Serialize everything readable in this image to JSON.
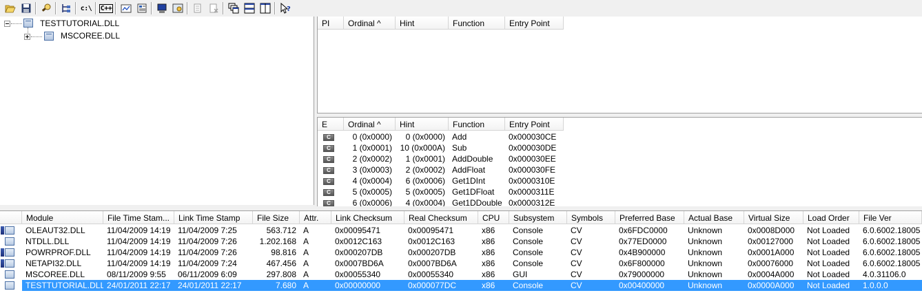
{
  "toolbar": {
    "buttons": [
      {
        "icon": "open-folder-icon"
      },
      {
        "icon": "save-icon"
      },
      {
        "icon": "find-icon"
      },
      {
        "icon": "module-tree-icon"
      },
      {
        "label": "c:\\"
      },
      {
        "label": "C++"
      },
      {
        "icon": "profile-icon"
      },
      {
        "icon": "properties-icon"
      },
      {
        "icon": "computer-icon"
      },
      {
        "icon": "view-icon"
      },
      {
        "icon": "copy-icon"
      },
      {
        "icon": "delete-icon"
      },
      {
        "icon": "cascade-icon"
      },
      {
        "icon": "tile-horizontal-icon"
      },
      {
        "icon": "tile-vertical-icon"
      },
      {
        "icon": "help-icon"
      }
    ]
  },
  "tree": {
    "root": "TESTTUTORIAL.DLL",
    "child": "MSCOREE.DLL"
  },
  "imports": {
    "headers": [
      "PI",
      "Ordinal ^",
      "Hint",
      "Function",
      "Entry Point"
    ]
  },
  "exports": {
    "headers": [
      "E",
      "Ordinal ^",
      "Hint",
      "Function",
      "Entry Point"
    ],
    "badge": "C",
    "rows": [
      {
        "ordinal": "0 (0x0000)",
        "hint": "0 (0x0000)",
        "function": "Add",
        "entry": "0x000030CE"
      },
      {
        "ordinal": "1 (0x0001)",
        "hint": "10 (0x000A)",
        "function": "Sub",
        "entry": "0x000030DE"
      },
      {
        "ordinal": "2 (0x0002)",
        "hint": "1 (0x0001)",
        "function": "AddDouble",
        "entry": "0x000030EE"
      },
      {
        "ordinal": "3 (0x0003)",
        "hint": "2 (0x0002)",
        "function": "AddFloat",
        "entry": "0x000030FE"
      },
      {
        "ordinal": "4 (0x0004)",
        "hint": "6 (0x0006)",
        "function": "Get1DInt",
        "entry": "0x0000310E"
      },
      {
        "ordinal": "5 (0x0005)",
        "hint": "5 (0x0005)",
        "function": "Get1DFloat",
        "entry": "0x0000311E"
      },
      {
        "ordinal": "6 (0x0006)",
        "hint": "4 (0x0004)",
        "function": "Get1DDouble",
        "entry": "0x0000312E"
      }
    ]
  },
  "modules": {
    "headers": [
      "",
      "Module",
      "File Time Stam...",
      "Link Time Stamp",
      "File Size",
      "Attr.",
      "Link Checksum",
      "Real Checksum",
      "CPU",
      "Subsystem",
      "Symbols",
      "Preferred Base",
      "Actual Base",
      "Virtual Size",
      "Load Order",
      "File Ver"
    ],
    "rows": [
      {
        "icon": "warn",
        "module": "OLEAUT32.DLL",
        "file_time": "11/04/2009 14:19",
        "link_time": "11/04/2009  7:25",
        "size": "563.712",
        "attr": "A",
        "link_ck": "0x00095471",
        "real_ck": "0x00095471",
        "cpu": "x86",
        "subsystem": "Console",
        "symbols": "CV",
        "pref_base": "0x6FDC0000",
        "actual_base": "Unknown",
        "vsize": "0x0008D000",
        "load_order": "Not Loaded",
        "file_ver": "6.0.6002.18005"
      },
      {
        "icon": "plain",
        "module": "NTDLL.DLL",
        "file_time": "11/04/2009 14:19",
        "link_time": "11/04/2009  7:26",
        "size": "1.202.168",
        "attr": "A",
        "link_ck": "0x0012C163",
        "real_ck": "0x0012C163",
        "cpu": "x86",
        "subsystem": "Console",
        "symbols": "CV",
        "pref_base": "0x77ED0000",
        "actual_base": "Unknown",
        "vsize": "0x00127000",
        "load_order": "Not Loaded",
        "file_ver": "6.0.6002.18005"
      },
      {
        "icon": "warn",
        "module": "POWRPROF.DLL",
        "file_time": "11/04/2009 14:19",
        "link_time": "11/04/2009  7:26",
        "size": "98.816",
        "attr": "A",
        "link_ck": "0x000207DB",
        "real_ck": "0x000207DB",
        "cpu": "x86",
        "subsystem": "Console",
        "symbols": "CV",
        "pref_base": "0x4B900000",
        "actual_base": "Unknown",
        "vsize": "0x0001A000",
        "load_order": "Not Loaded",
        "file_ver": "6.0.6002.18005"
      },
      {
        "icon": "warn",
        "module": "NETAPI32.DLL",
        "file_time": "11/04/2009 14:19",
        "link_time": "11/04/2009  7:24",
        "size": "467.456",
        "attr": "A",
        "link_ck": "0x0007BD6A",
        "real_ck": "0x0007BD6A",
        "cpu": "x86",
        "subsystem": "Console",
        "symbols": "CV",
        "pref_base": "0x6F800000",
        "actual_base": "Unknown",
        "vsize": "0x00076000",
        "load_order": "Not Loaded",
        "file_ver": "6.0.6002.18005"
      },
      {
        "icon": "plain",
        "module": "MSCOREE.DLL",
        "file_time": "08/11/2009  9:55",
        "link_time": "06/11/2009  6:09",
        "size": "297.808",
        "attr": "A",
        "link_ck": "0x00055340",
        "real_ck": "0x00055340",
        "cpu": "x86",
        "subsystem": "GUI",
        "symbols": "CV",
        "pref_base": "0x79000000",
        "actual_base": "Unknown",
        "vsize": "0x0004A000",
        "load_order": "Not Loaded",
        "file_ver": "4.0.31106.0"
      },
      {
        "icon": "plain",
        "module": "TESTTUTORIAL.DLL",
        "file_time": "24/01/2011 22:17",
        "link_time": "24/01/2011 22:17",
        "size": "7.680",
        "attr": "A",
        "link_ck": "0x00000000",
        "real_ck": "0x000077DC",
        "cpu": "x86",
        "subsystem": "Console",
        "symbols": "CV",
        "pref_base": "0x00400000",
        "actual_base": "Unknown",
        "vsize": "0x0000A000",
        "load_order": "Not Loaded",
        "file_ver": "1.0.0.0",
        "selected": true
      }
    ]
  }
}
